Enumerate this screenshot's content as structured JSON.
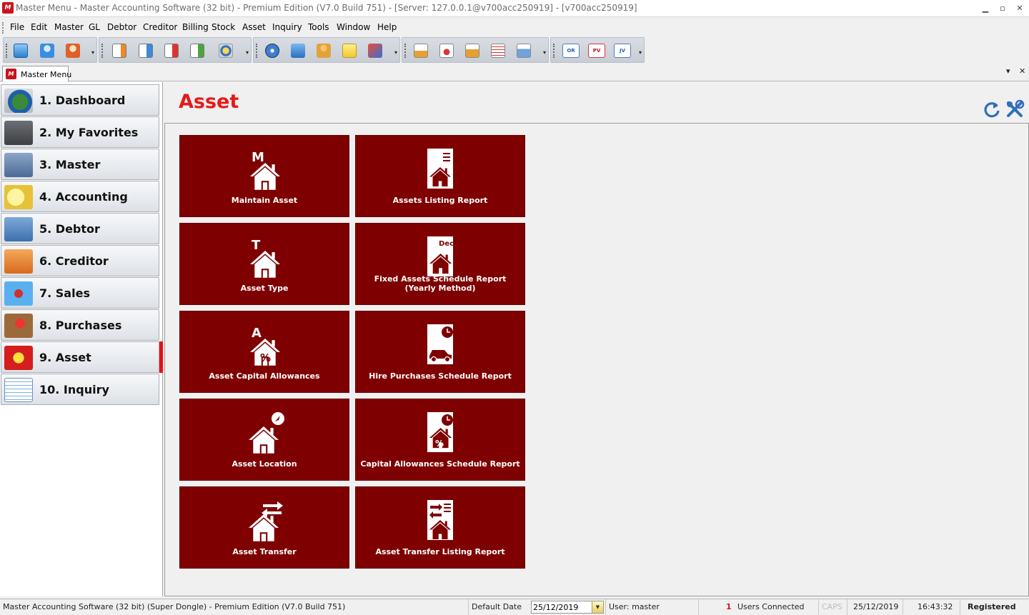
{
  "window": {
    "title": "Master Menu - Master Accounting Software (32 bit) - Premium Edition (V7.0 Build 751) - [Server: 127.0.0.1@v700acc250919] - [v700acc250919]",
    "icon_text": "M"
  },
  "menubar": {
    "items": [
      "File",
      "Edit",
      "Master",
      "GL",
      "Debtor",
      "Creditor",
      "Billing",
      "Stock",
      "Asset",
      "Inquiry",
      "Tools",
      "Window",
      "Help"
    ]
  },
  "toolbar": {
    "buttons": [
      {
        "icon": "calendar-grid-icon"
      },
      {
        "icon": "user-blue-icon"
      },
      {
        "icon": "user-orange-icon"
      },
      {
        "icon": "document-user-icon"
      },
      {
        "icon": "document-globe-icon"
      },
      {
        "icon": "document-red-icon"
      },
      {
        "icon": "document-green-icon"
      },
      {
        "icon": "sync-icon"
      },
      {
        "icon": "compass-icon"
      },
      {
        "icon": "upload-user-icon"
      },
      {
        "icon": "person-icon"
      },
      {
        "icon": "folder-icon"
      },
      {
        "icon": "s-logo-icon"
      },
      {
        "icon": "balance-report-icon"
      },
      {
        "icon": "dollar-report-icon"
      },
      {
        "icon": "scale-report-icon"
      },
      {
        "icon": "list-report-icon"
      },
      {
        "icon": "fields-report-icon"
      },
      {
        "label": "OR"
      },
      {
        "label": "PV"
      },
      {
        "label": "JV"
      }
    ]
  },
  "doc_tabs": [
    {
      "label": "Master Menu",
      "icon_text": "M"
    }
  ],
  "sidebar": {
    "items": [
      {
        "label": "1. Dashboard",
        "icon": "dashboard-globe-icon",
        "active": false
      },
      {
        "label": "2. My Favorites",
        "icon": "favorites-star-folder-icon",
        "active": false
      },
      {
        "label": "3. Master",
        "icon": "master-tools-icon",
        "active": false
      },
      {
        "label": "4. Accounting",
        "icon": "accounting-book-icon",
        "active": false
      },
      {
        "label": "5. Debtor",
        "icon": "debtor-folder-icon",
        "active": false
      },
      {
        "label": "6. Creditor",
        "icon": "creditor-folder-icon",
        "active": false
      },
      {
        "label": "7. Sales",
        "icon": "sales-tags-icon",
        "active": false
      },
      {
        "label": "8. Purchases",
        "icon": "purchases-icon",
        "active": false
      },
      {
        "label": "9. Asset",
        "icon": "asset-house-icon",
        "active": true
      },
      {
        "label": "10. Inquiry",
        "icon": "inquiry-sheets-icon",
        "active": false
      }
    ]
  },
  "main": {
    "title": "Asset",
    "title_color": "#e51a1a",
    "tile_color": "#7e0000",
    "tiles": [
      {
        "label": "Maintain Asset",
        "icon": "house-letter-m-icon",
        "glyph": "M"
      },
      {
        "label": "Assets Listing Report",
        "icon": "report-house-icon",
        "glyph": ""
      },
      {
        "label": "Asset Type",
        "icon": "house-letter-t-icon",
        "glyph": "T"
      },
      {
        "label": "Fixed Assets Schedule Report (Yearly Method)",
        "icon": "report-dec-house-icon",
        "glyph": "Dec"
      },
      {
        "label": "Asset Capital Allowances",
        "icon": "house-percent-icon",
        "glyph": "A"
      },
      {
        "label": "Hire Purchases Schedule Report",
        "icon": "report-car-clock-icon",
        "glyph": ""
      },
      {
        "label": "Asset Location",
        "icon": "house-compass-icon",
        "glyph": ""
      },
      {
        "label": "Capital Allowances Schedule Report",
        "icon": "report-percent-clock-icon",
        "glyph": "%"
      },
      {
        "label": "Asset Transfer",
        "icon": "house-transfer-icon",
        "glyph": ""
      },
      {
        "label": "Asset Transfer Listing Report",
        "icon": "report-transfer-icon",
        "glyph": ""
      }
    ]
  },
  "statusbar": {
    "app_info": "Master Accounting Software (32 bit) (Super Dongle) - Premium Edition (V7.0 Build 751)",
    "default_date_label": "Default Date",
    "default_date_value": "25/12/2019",
    "user": "User: master",
    "users_connected_count": "1",
    "users_connected_label": "Users Connected",
    "caps": "CAPS",
    "date": "25/12/2019",
    "time": "16:43:32",
    "registration": "Registered"
  }
}
